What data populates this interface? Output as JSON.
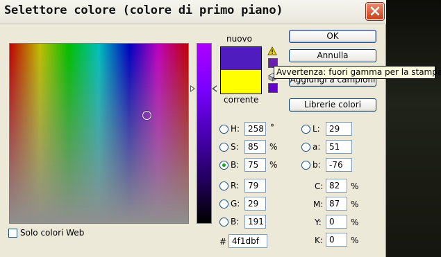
{
  "window": {
    "title": "Selettore colore (colore di primo piano)"
  },
  "swatches": {
    "new_label": "nuovo",
    "current_label": "corrente",
    "new_color": "#4f1dbf",
    "current_color": "#ffff00",
    "gamut_color": "#6a1fb0",
    "web_color": "#6600cc"
  },
  "buttons": {
    "ok": "OK",
    "cancel": "Annulla",
    "add_swatches": "Aggiungi a campioni",
    "color_libraries": "Librerie colori"
  },
  "tooltip": "Avvertenza: fuori gamma per la stampa",
  "hsb": {
    "h_label": "H:",
    "h_value": "258",
    "h_unit": "°",
    "s_label": "S:",
    "s_value": "85",
    "s_unit": "%",
    "b_label": "B:",
    "b_value": "75",
    "b_unit": "%"
  },
  "rgb": {
    "r_label": "R:",
    "r_value": "79",
    "g_label": "G:",
    "g_value": "29",
    "b_label": "B:",
    "b_value": "191"
  },
  "lab": {
    "l_label": "L:",
    "l_value": "29",
    "a_label": "a:",
    "a_value": "51",
    "b_label": "b:",
    "b_value": "-76"
  },
  "cmyk": {
    "c_label": "C:",
    "c_value": "82",
    "c_unit": "%",
    "m_label": "M:",
    "m_value": "87",
    "m_unit": "%",
    "y_label": "Y:",
    "y_value": "0",
    "y_unit": "%",
    "k_label": "K:",
    "k_value": "0",
    "k_unit": "%"
  },
  "hex": {
    "label": "#",
    "value": "4f1dbf"
  },
  "web_only": {
    "label": "Solo colori Web",
    "checked": false
  },
  "selected_mode": "B"
}
